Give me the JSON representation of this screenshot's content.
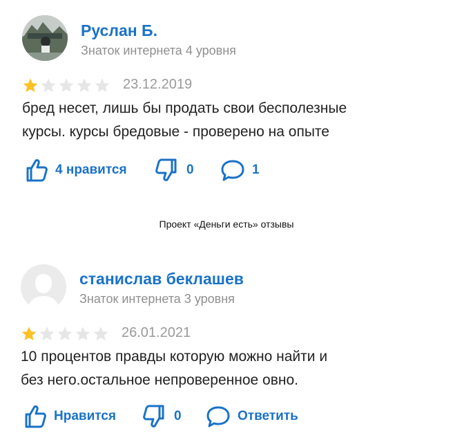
{
  "reviews": [
    {
      "author": "Руслан Б.",
      "level": "Знаток интернета 4 уровня",
      "rating": 1,
      "max_rating": 5,
      "date": "23.12.2019",
      "text_lines": [
        "бред несет, лишь бы продать свои бесполезные",
        "курсы. курсы бредовые - проверено на опыте"
      ],
      "likes_label": "4 нравится",
      "dislikes": "0",
      "comments_label": "1",
      "avatar_type": "photo"
    },
    {
      "author": "станислав беклашев",
      "level": "Знаток интернета 3 уровня",
      "rating": 1,
      "max_rating": 5,
      "date": "26.01.2021",
      "text_lines": [
        "10 процентов правды которую можно найти и",
        "без него.остальное непроверенное овно."
      ],
      "likes_label": "Нравится",
      "dislikes": "0",
      "comments_label": "Ответить",
      "avatar_type": "placeholder"
    }
  ],
  "caption": "Проект «Деньги есть» отзывы",
  "colors": {
    "link": "#1a72c7",
    "star_filled": "#fcc224",
    "star_empty": "#e6e6e6",
    "muted": "#8f8f8f"
  },
  "icons": {
    "like": "thumbs-up-icon",
    "dislike": "thumbs-down-icon",
    "comment": "speech-bubble-icon"
  }
}
